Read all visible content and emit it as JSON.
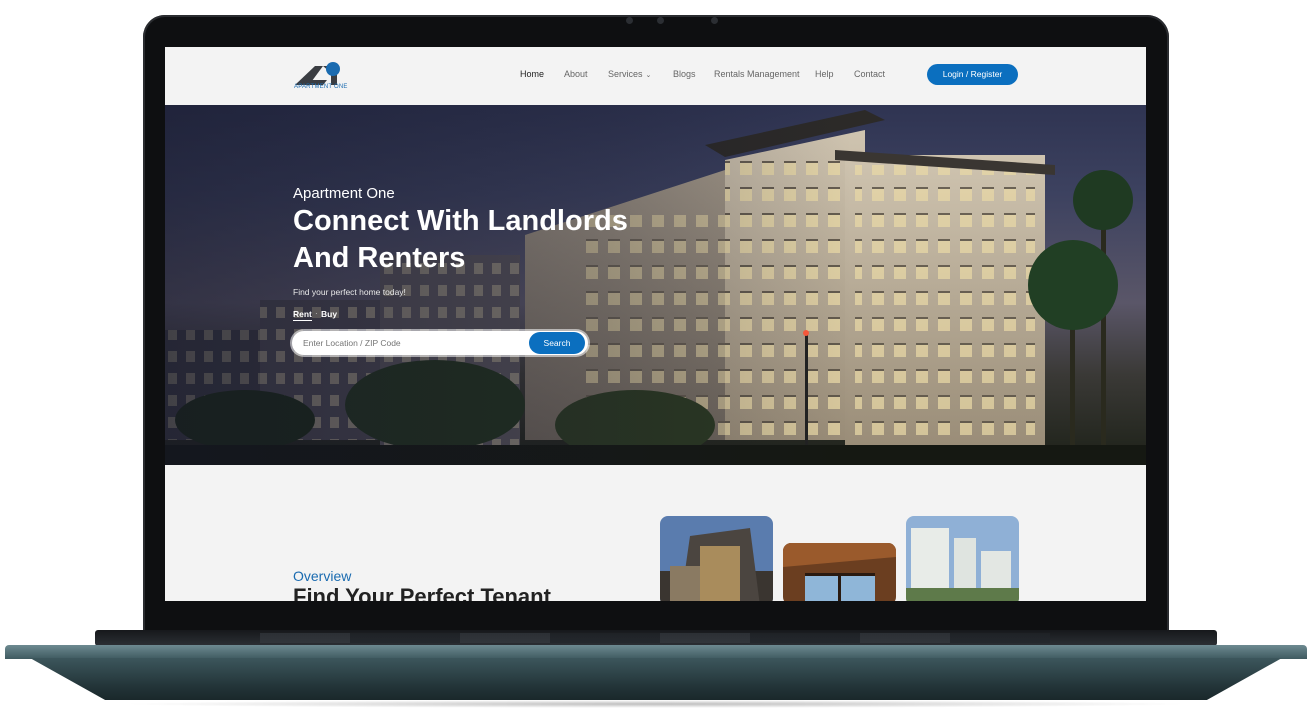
{
  "nav": {
    "brand": "APARTMENT ONE",
    "items": [
      {
        "label": "Home",
        "active": true
      },
      {
        "label": "About"
      },
      {
        "label": "Services",
        "dropdown": true
      },
      {
        "label": "Blogs"
      },
      {
        "label": "Rentals Management"
      },
      {
        "label": "Help"
      },
      {
        "label": "Contact"
      }
    ],
    "login_label": "Login / Register"
  },
  "hero": {
    "eyebrow": "Apartment One",
    "headline": "Connect With Landlords And Renters",
    "subtitle": "Find your perfect home today!",
    "tabs": [
      "Rent",
      "Buy"
    ],
    "search_placeholder": "Enter Location / ZIP Code",
    "search_button": "Search"
  },
  "overview": {
    "label": "Overview",
    "title": "Find Your Perfect Tenant"
  },
  "colors": {
    "accent": "#0b6fbf",
    "link_blue": "#1a6bb0"
  }
}
